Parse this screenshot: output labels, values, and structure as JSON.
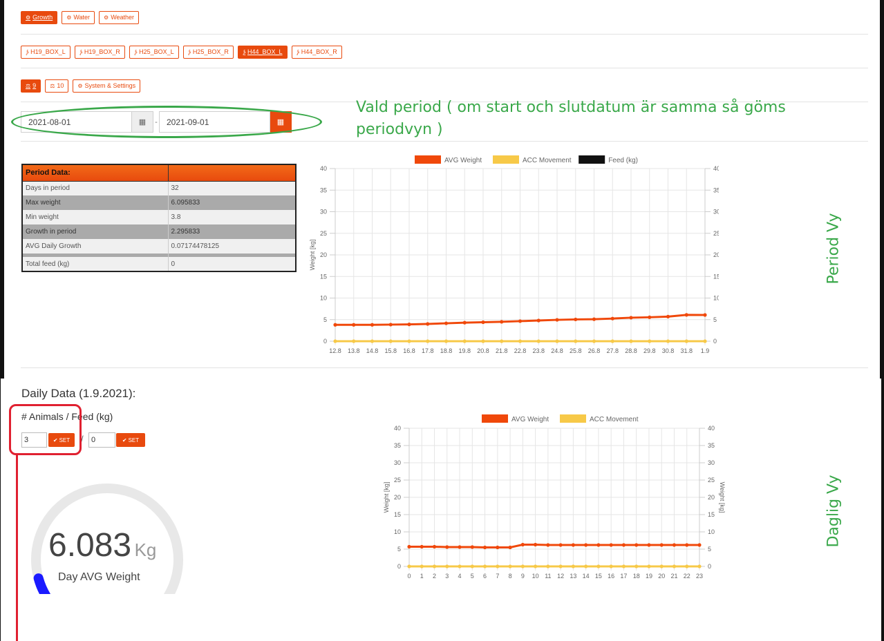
{
  "nav": {
    "row1": [
      {
        "label": "Growth",
        "icon": "gear-icon",
        "active": true
      },
      {
        "label": "Water",
        "icon": "gear-icon",
        "active": false
      },
      {
        "label": "Weather",
        "icon": "gear-icon",
        "active": false
      }
    ],
    "row2": [
      {
        "label": "H19_BOX_L",
        "icon": "rss-icon",
        "active": false
      },
      {
        "label": "H19_BOX_R",
        "icon": "rss-icon",
        "active": false
      },
      {
        "label": "H25_BOX_L",
        "icon": "rss-icon",
        "active": false
      },
      {
        "label": "H25_BOX_R",
        "icon": "rss-icon",
        "active": false
      },
      {
        "label": "H44_BOX_L",
        "icon": "rss-icon",
        "active": true
      },
      {
        "label": "H44_BOX_R",
        "icon": "rss-icon",
        "active": false
      }
    ],
    "row3": [
      {
        "label": "9",
        "icon": "scale-icon",
        "active": true
      },
      {
        "label": "10",
        "icon": "scale-icon",
        "active": false
      },
      {
        "label": "System & Settings",
        "icon": "cogs-icon",
        "active": false
      }
    ]
  },
  "period": {
    "start": "2021-08-01",
    "end": "2021-09-01",
    "separator": "-"
  },
  "annotations": {
    "period_note_line1": "Vald period ( om start och slutdatum är samma så göms",
    "period_note_line2": "periodvyn )",
    "period_view": "Period Vy",
    "daily_view": "Daglig Vy"
  },
  "period_table": {
    "header": "Period Data:",
    "header2": "",
    "rows": [
      {
        "label": "Days in period",
        "value": "32"
      },
      {
        "label": "Max weight",
        "value": "6.095833"
      },
      {
        "label": "Min weight",
        "value": "3.8"
      },
      {
        "label": "Growth in period",
        "value": "2.295833"
      },
      {
        "label": "AVG Daily Growth",
        "value": "0.07174478125"
      },
      {
        "label": "Total feed (kg)",
        "value": "0"
      }
    ]
  },
  "daily": {
    "title": "Daily Data (1.9.2021):",
    "animals_feed_label": "# Animals / Feed (kg)",
    "animals_value": "3",
    "feed_value": "0",
    "set_label": "SET",
    "slash": "/",
    "gauge_value": "6.083",
    "gauge_unit": "Kg",
    "gauge_label": "Day AVG Weight",
    "gauge_fraction": 0.07
  },
  "colors": {
    "accent": "#e84a0e",
    "avg_weight": "#f0480a",
    "acc_movement": "#f7c948",
    "feed": "#111111",
    "annotation_green": "#3aa84a",
    "annotation_red": "#e02030",
    "gauge_fill": "#1a1aff",
    "gauge_track": "#e8e8e8"
  },
  "chart_data": [
    {
      "type": "line",
      "legend": [
        "AVG Weight",
        "ACC Movement",
        "Feed (kg)"
      ],
      "legend_position": "top",
      "grid": true,
      "ylabel": "Weight [kg]",
      "y2label": "Weight [kg]",
      "ylim": [
        0,
        40
      ],
      "yticks": [
        "0",
        "5",
        "10",
        "15",
        "20",
        "25",
        "30",
        "35",
        "40"
      ],
      "categories": [
        "12.8",
        "13.8",
        "14.8",
        "15.8",
        "16.8",
        "17.8",
        "18.8",
        "19.8",
        "20.8",
        "21.8",
        "22.8",
        "23.8",
        "24.8",
        "25.8",
        "26.8",
        "27.8",
        "28.8",
        "29.8",
        "30.8",
        "31.8",
        "1.9"
      ],
      "series": [
        {
          "name": "AVG Weight",
          "values": [
            3.8,
            3.8,
            3.8,
            3.85,
            3.9,
            4.0,
            4.15,
            4.3,
            4.4,
            4.5,
            4.65,
            4.8,
            4.95,
            5.05,
            5.1,
            5.25,
            5.45,
            5.55,
            5.7,
            6.1,
            6.08
          ]
        },
        {
          "name": "ACC Movement",
          "values": [
            0,
            0,
            0,
            0,
            0,
            0,
            0,
            0,
            0,
            0,
            0,
            0,
            0,
            0,
            0,
            0,
            0,
            0,
            0,
            0,
            0
          ]
        }
      ]
    },
    {
      "type": "line",
      "legend": [
        "AVG Weight",
        "ACC Movement"
      ],
      "legend_position": "top",
      "grid": true,
      "ylabel": "Weight [kg]",
      "y2label": "Weight [kg]",
      "ylim": [
        0,
        40
      ],
      "yticks": [
        "0",
        "5",
        "10",
        "15",
        "20",
        "25",
        "30",
        "35",
        "40"
      ],
      "categories": [
        "0",
        "1",
        "2",
        "3",
        "4",
        "5",
        "6",
        "7",
        "8",
        "9",
        "10",
        "11",
        "12",
        "13",
        "14",
        "15",
        "16",
        "17",
        "18",
        "19",
        "20",
        "21",
        "22",
        "23"
      ],
      "series": [
        {
          "name": "AVG Weight",
          "values": [
            5.7,
            5.7,
            5.7,
            5.6,
            5.6,
            5.6,
            5.5,
            5.5,
            5.5,
            6.3,
            6.3,
            6.2,
            6.2,
            6.2,
            6.2,
            6.2,
            6.2,
            6.2,
            6.2,
            6.2,
            6.2,
            6.2,
            6.2,
            6.2
          ]
        },
        {
          "name": "ACC Movement",
          "values": [
            0,
            0,
            0,
            0,
            0,
            0,
            0,
            0,
            0,
            0,
            0,
            0,
            0,
            0,
            0,
            0,
            0,
            0,
            0,
            0,
            0,
            0,
            0,
            0
          ]
        }
      ]
    }
  ]
}
